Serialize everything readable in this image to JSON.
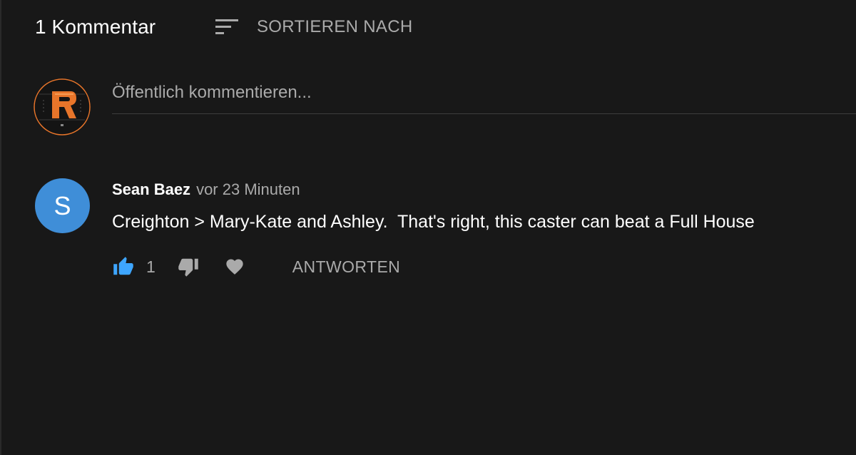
{
  "header": {
    "comment_count": "1 Kommentar",
    "sort_label": "SORTIEREN NACH"
  },
  "compose": {
    "placeholder": "Öffentlich kommentieren..."
  },
  "comments": [
    {
      "avatar_letter": "S",
      "avatar_color": "#3f8ed8",
      "author": "Sean Baez",
      "time": "vor 23 Minuten",
      "text": "Creighton > Mary-Kate and Ashley.  That's right, this caster can beat a Full House",
      "like_count": "1",
      "reply_label": "ANTWORTEN"
    }
  ],
  "colors": {
    "background": "#181818",
    "like_active": "#3ea6ff",
    "secondary_text": "#aaaaaa",
    "avatar_accent": "#e8752a"
  },
  "icons": {
    "sort": "sort-icon",
    "like": "thumb-up-icon",
    "dislike": "thumb-down-icon",
    "heart": "heart-icon"
  }
}
